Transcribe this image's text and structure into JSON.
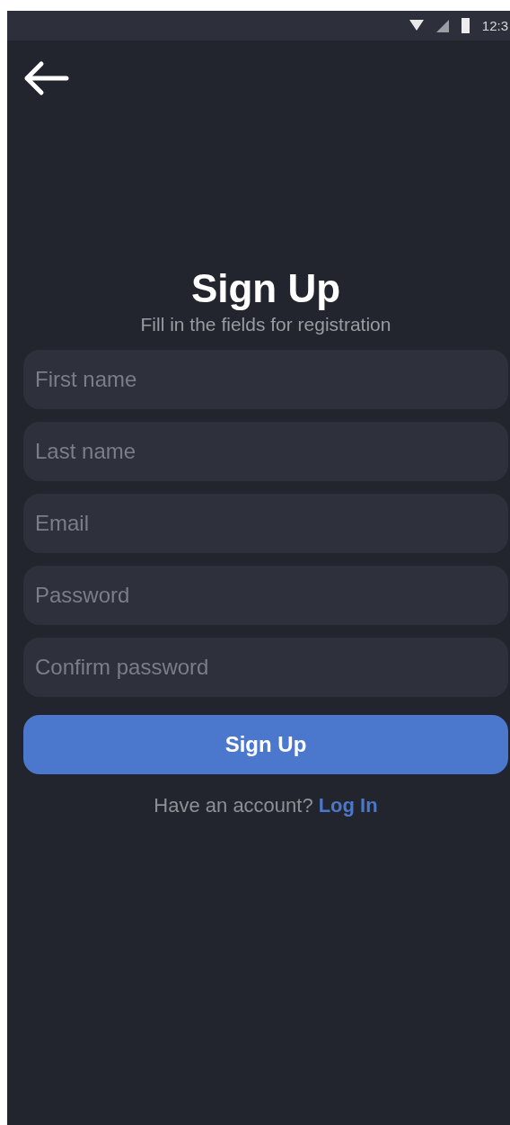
{
  "status_bar": {
    "time": "12:3"
  },
  "title": "Sign Up",
  "subtitle": "Fill in the fields for registration",
  "fields": [
    {
      "placeholder": "First name"
    },
    {
      "placeholder": "Last name"
    },
    {
      "placeholder": "Email"
    },
    {
      "placeholder": "Password"
    },
    {
      "placeholder": "Confirm password"
    }
  ],
  "submit_button": "Sign Up",
  "footer": {
    "text": "Have an account?",
    "link": "Log In"
  }
}
